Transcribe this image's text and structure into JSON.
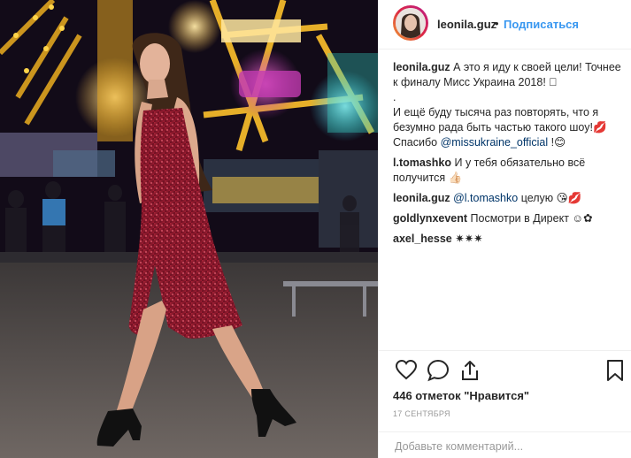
{
  "post": {
    "username": "leonila.guz",
    "separator": "•",
    "follow_label": "Подписаться",
    "photo_alt": "leonila.guz"
  },
  "comments": [
    {
      "user": "leonila.guz",
      "text": "А это я иду к своей цели! Точнее к финалу Мисс Украина 2018! 🏻",
      "line2": ".",
      "line3": "И ещё буду тысяча раз повторять, что я безумно рада быть частью такого шоу!💋 Спасибо ",
      "mention": "@missukraine_official",
      "tail": " !😊"
    },
    {
      "user": "l.tomashko",
      "text": "И у тебя обязательно всё получится 👍🏻"
    },
    {
      "user": "leonila.guz",
      "mention": "@l.tomashko",
      "text": " целую 😘💋"
    },
    {
      "user": "goldlynxevent",
      "text": "Посмотри в Директ ☺✿"
    },
    {
      "user": "axel_hesse",
      "text": "✷✷✷"
    }
  ],
  "footer": {
    "likes": "446 отметок \"Нравится\"",
    "date": "17 СЕНТЯБРЯ",
    "comment_placeholder": "Добавьте комментарий..."
  },
  "colors": {
    "accent": "#3897f0",
    "dress": "#8b1a2b",
    "border": "#efefef"
  },
  "icons": [
    "heart-icon",
    "comment-icon",
    "share-icon",
    "bookmark-icon"
  ]
}
